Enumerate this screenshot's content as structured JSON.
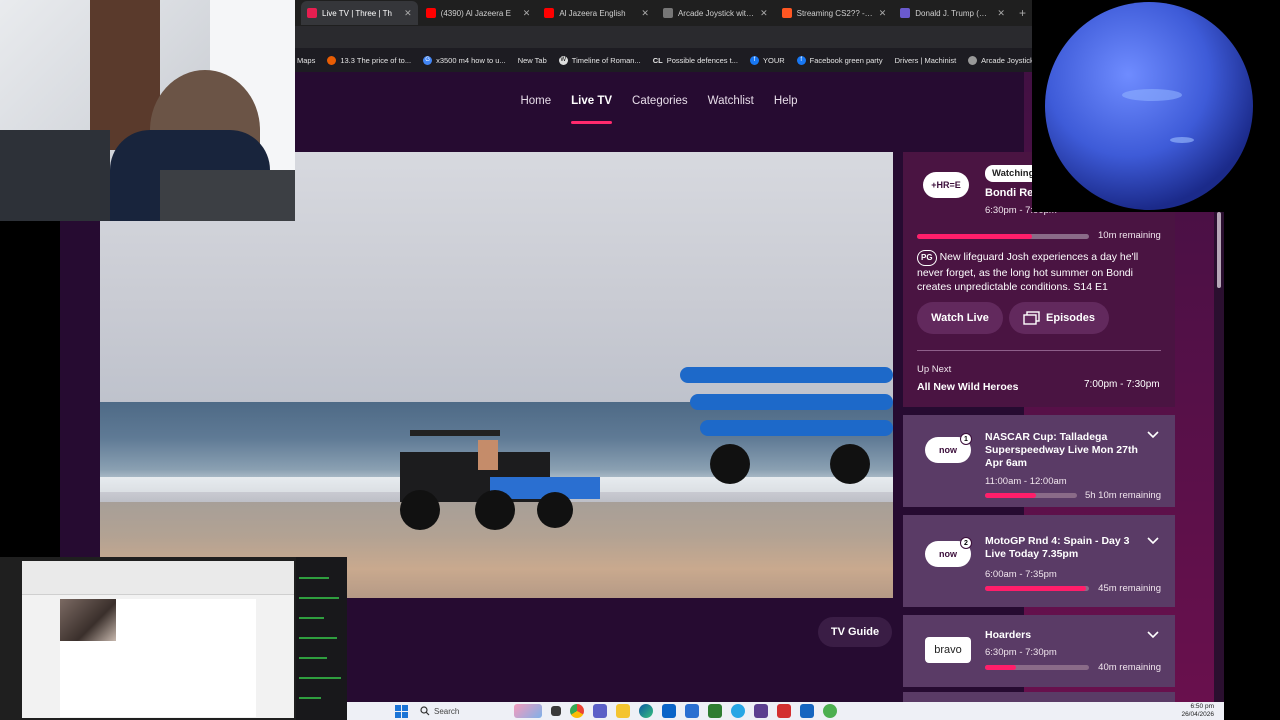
{
  "browser": {
    "tabs": [
      {
        "title": "Live TV | Three | Th",
        "color": "#e61e50",
        "active": true
      },
      {
        "title": "(4390) Al Jazeera E",
        "color": "#ff0000",
        "active": false
      },
      {
        "title": "Al Jazeera English",
        "color": "#ff0000",
        "active": false
      },
      {
        "title": "Arcade Joystick with M",
        "color": "#444444",
        "active": false
      },
      {
        "title": "Streaming CS2?? - No",
        "color": "#ff5722",
        "active": false
      },
      {
        "title": "Donald J. Trump (@rea",
        "color": "#6a5acd",
        "active": false
      }
    ],
    "bookmarks": [
      {
        "label": "Maps",
        "icon": "M"
      },
      {
        "label": "13.3 The price of to...",
        "icon": ""
      },
      {
        "label": "x3500 m4 how to u...",
        "icon": "G"
      },
      {
        "label": "New Tab",
        "icon": ""
      },
      {
        "label": "Timeline of Roman...",
        "icon": "W"
      },
      {
        "label": "Possible defences t...",
        "icon": "CL"
      },
      {
        "label": "YOUR",
        "icon": "f"
      },
      {
        "label": "Facebook green party",
        "icon": "f"
      },
      {
        "label": "Drivers | Machinist",
        "icon": ""
      },
      {
        "label": "Arcade Joystick w",
        "icon": ""
      }
    ]
  },
  "nav": {
    "items": [
      {
        "label": "Home",
        "active": false
      },
      {
        "label": "Live TV",
        "active": true
      },
      {
        "label": "Categories",
        "active": false
      },
      {
        "label": "Watchlist",
        "active": false
      },
      {
        "label": "Help",
        "active": false
      }
    ]
  },
  "player": {
    "tv_guide_label": "TV Guide"
  },
  "current": {
    "channel_logo": "+HR=E",
    "badge": "Watching",
    "title": "Bondi Res",
    "time": "6:30pm - 7:00pm",
    "progress": 0.67,
    "remaining": "10m remaining",
    "rating": "PG",
    "description": "New lifeguard Josh experiences a day he'll never forget, as the long hot summer on Bondi creates unpredictable conditions. S14 E1",
    "watch_live_label": "Watch Live",
    "episodes_label": "Episodes",
    "up_next_label": "Up Next",
    "up_next_title": "All New Wild Heroes",
    "up_next_time": "7:00pm - 7:30pm"
  },
  "channels": [
    {
      "logo": "now",
      "badge": "1",
      "title": "NASCAR Cup: Talladega Superspeedway Live Mon 27th Apr 6am",
      "time": "11:00am - 12:00am",
      "progress": 0.55,
      "remaining": "5h 10m remaining"
    },
    {
      "logo": "now",
      "badge": "2",
      "title": "MotoGP Rnd 4: Spain - Day 3 Live Today 7.35pm",
      "time": "6:00am - 7:35pm",
      "progress": 0.97,
      "remaining": "45m remaining"
    },
    {
      "logo": "bravo",
      "badge": "",
      "title": "Hoarders",
      "time": "6:30pm - 7:30pm",
      "progress": 0.3,
      "remaining": "40m remaining"
    }
  ],
  "taskbar": {
    "search_label": "Search",
    "time": "6:50 pm",
    "date": "26/04/2026"
  }
}
